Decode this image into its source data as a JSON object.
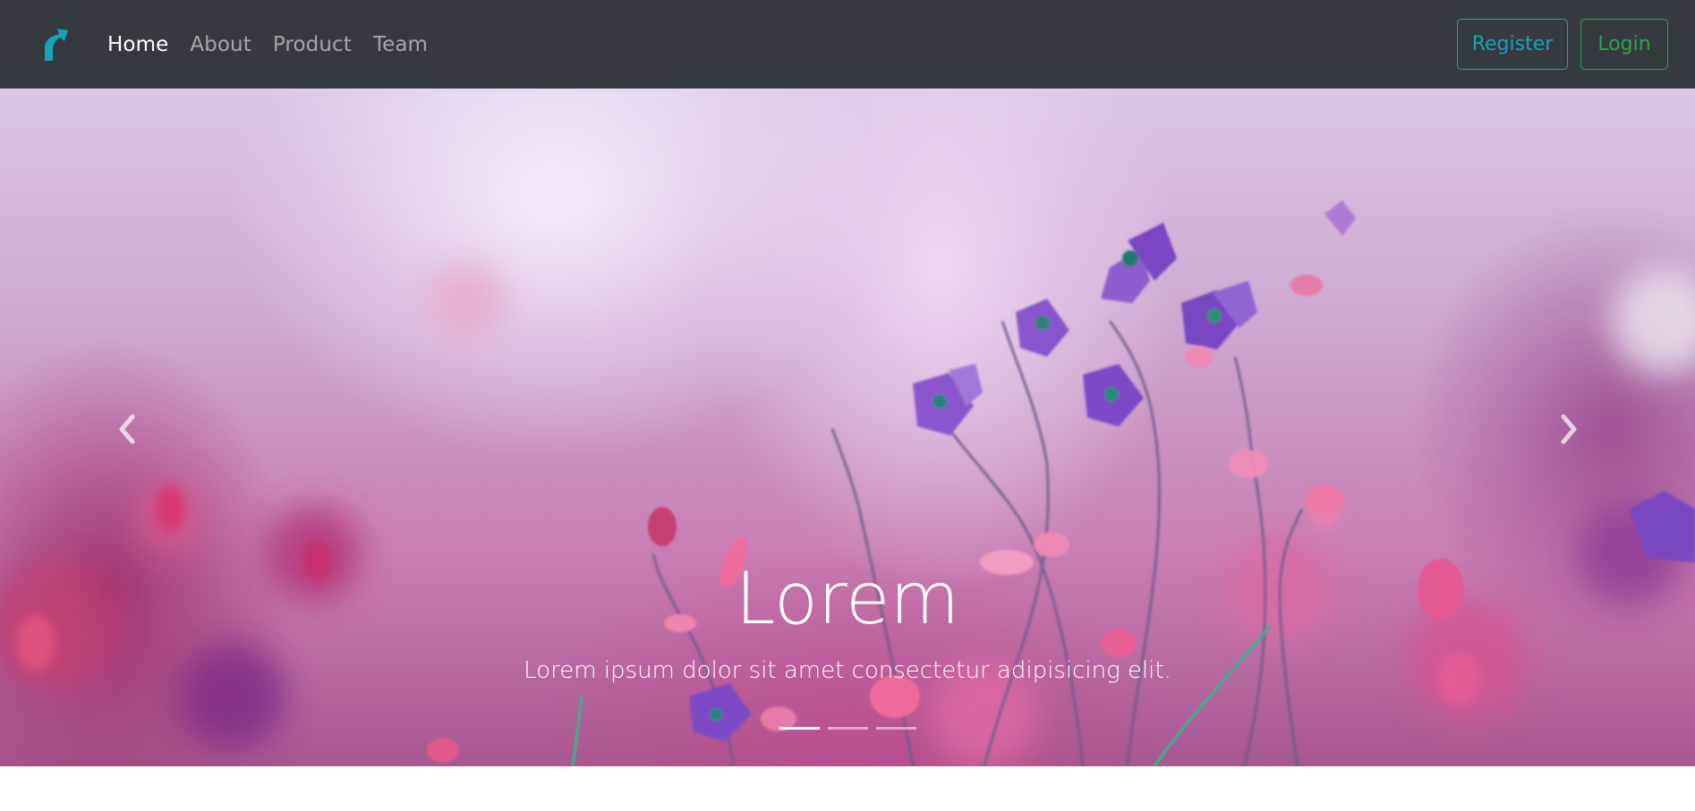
{
  "navbar": {
    "brand_icon": "arrow-curve-up-right-icon",
    "brand_color": "#17a2b8",
    "links": [
      {
        "label": "Home",
        "active": true
      },
      {
        "label": "About",
        "active": false
      },
      {
        "label": "Product",
        "active": false
      },
      {
        "label": "Team",
        "active": false
      }
    ],
    "register_label": "Register",
    "login_label": "Login",
    "colors": {
      "background": "#343a40",
      "register": "#17a2b8",
      "login": "#28a745"
    }
  },
  "carousel": {
    "prev_icon": "chevron-left-icon",
    "next_icon": "chevron-right-icon",
    "caption_title": "Lorem",
    "caption_text": "Lorem ipsum dolor sit amet consectetur adipisicing elit.",
    "indicators": [
      {
        "active": true
      },
      {
        "active": false
      },
      {
        "active": false
      }
    ]
  }
}
